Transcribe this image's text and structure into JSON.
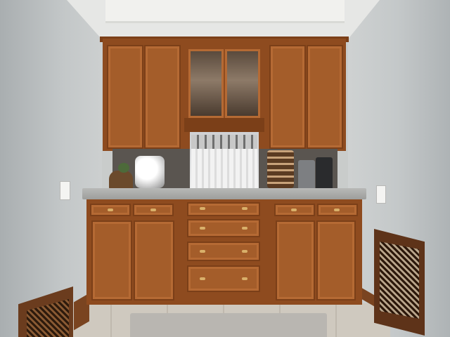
{
  "scene": {
    "description_labels": {
      "room": "kitchen-bar-alcove"
    },
    "colors": {
      "wood": "#9b5526",
      "wood_dark": "#7b3f18",
      "wall": "#c6c9ca",
      "countertop": "#a9aaa8",
      "floor_tile": "#cfc9bf",
      "hardware": "#d9b06a"
    },
    "icons": {
      "wall_switch": "light-switch-icon",
      "wall_outlet": "outlet-icon"
    }
  }
}
